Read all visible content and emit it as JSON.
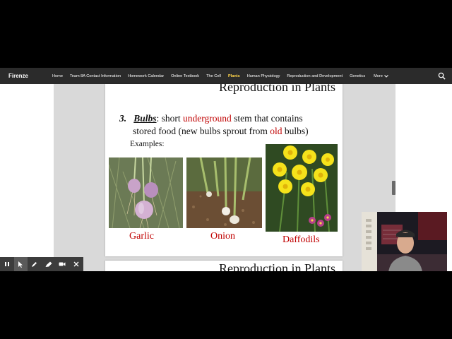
{
  "site": {
    "title": "Firenze",
    "nav": [
      {
        "label": "Home",
        "active": false
      },
      {
        "label": "Team 8A Contact Information",
        "active": false
      },
      {
        "label": "Homework Calendar",
        "active": false
      },
      {
        "label": "Online Textbook",
        "active": false
      },
      {
        "label": "The Cell",
        "active": false
      },
      {
        "label": "Plants",
        "active": true
      },
      {
        "label": "Human Physiology",
        "active": false
      },
      {
        "label": "Reproduction and Development",
        "active": false
      },
      {
        "label": "Genetics",
        "active": false
      }
    ],
    "more_label": "More",
    "search_icon": "search-icon",
    "active_color": "#ffd54a"
  },
  "slide1": {
    "title": "Reproduction in Plants",
    "number": "3.",
    "keyword": "Bulbs",
    "colon": ":  short ",
    "red1": "underground",
    "rest1": " stem that contains",
    "line2a": "stored food (new bulbs sprout from ",
    "red2": "old",
    "line2b": " bulbs)",
    "examples": "Examples:",
    "captions": {
      "garlic": "Garlic",
      "onion": "Onion",
      "daffodils": "Daffodils"
    }
  },
  "slide2": {
    "title": "Reproduction in Plants"
  },
  "toolbar": {
    "tools": [
      "pause-icon",
      "pointer-icon",
      "pen-icon",
      "highlighter-icon",
      "camera-icon",
      "close-icon"
    ]
  },
  "colors": {
    "caption_red": "#c00000",
    "nav_bg": "#2b2b2b"
  }
}
